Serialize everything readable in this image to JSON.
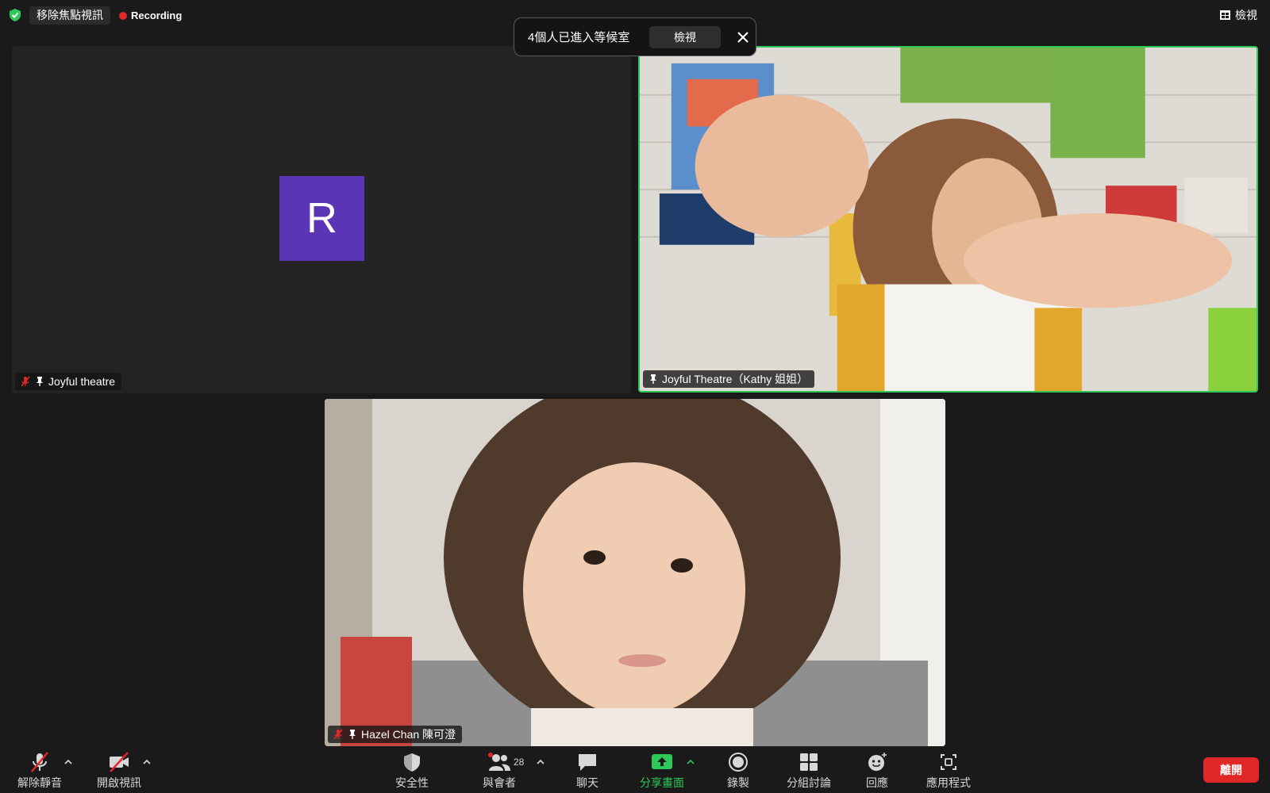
{
  "top_bar": {
    "remove_spotlight_label": "移除焦點視訊",
    "recording_label": "Recording",
    "view_label": "檢視"
  },
  "waiting_room_toast": {
    "message": "4個人已進入等候室",
    "view_button": "檢視"
  },
  "participants": [
    {
      "name": "Joyful theatre",
      "avatar_initial": "R",
      "avatar_color": "#5b35b5",
      "muted": true,
      "pinned": true,
      "video_on": false
    },
    {
      "name": "Joyful Theatre（Kathy 姐姐）",
      "muted": false,
      "pinned": true,
      "video_on": true,
      "active_speaker": true
    },
    {
      "name": "Hazel Chan 陳可澄",
      "muted": true,
      "pinned": true,
      "video_on": true
    }
  ],
  "toolbar": {
    "unmute_label": "解除靜音",
    "start_video_label": "開啟視訊",
    "security_label": "安全性",
    "participants_label": "與會者",
    "participants_count": "28",
    "chat_label": "聊天",
    "share_screen_label": "分享畫面",
    "record_label": "錄製",
    "breakout_label": "分組討論",
    "reactions_label": "回應",
    "apps_label": "應用程式",
    "leave_label": "離開"
  },
  "colors": {
    "active_speaker_border": "#2ec85a",
    "share_green": "#2ec85a",
    "leave_red": "#e02828",
    "recording_red": "#e02828"
  }
}
